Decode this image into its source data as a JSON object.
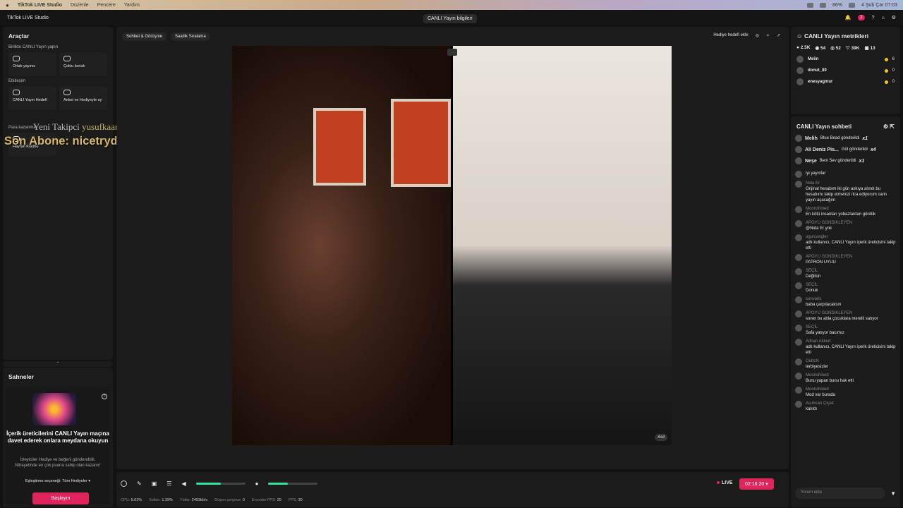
{
  "menubar": {
    "apple": "",
    "app": "TikTok LIVE Studio",
    "items": [
      "Düzenle",
      "Pencere",
      "Yardım"
    ],
    "battery": "86%",
    "datetime": "4 Şub Çar  07:03"
  },
  "titlebar": {
    "app_name": "TikTok LIVE Studio",
    "center": "CANLI Yayın bilgileri",
    "notif_count": "2"
  },
  "tools": {
    "title": "Araçlar",
    "section1": "Birlikte CANLI Yayın yapın",
    "btn1": "Ortak yayıncı",
    "btn2": "Çoklu konuk",
    "section2": "Etkileşim",
    "btn3": "CANLI Yayın Hedefi",
    "btn4": "Anket ve Hediyeyle oy",
    "section3": "Para kazanma",
    "btn5": "Hayran Kulübü"
  },
  "overlay": {
    "follower_label": "Yeni Takipci",
    "follower_name": "yusufkaan",
    "sub_label": "Son Abone: nicetrydiddyverynice"
  },
  "scenes": {
    "title": "Sahneler",
    "headline": "İçerik üreticilerini CANLI Yayın maçına davet ederek onlara meydana okuyun",
    "body": "İzleyiciler Hediye ve beğeni gönderebilir. Nihayetinde en çok puana sahip olan kazanır!",
    "selector": "Eşleştirme seçeneği: Tüm Hediyeler",
    "start": "Başlayın"
  },
  "stage": {
    "tab1": "Sohbet & Görüşme",
    "tab2": "Saatlik Sıralama",
    "gift_goal": "Hediye hedefi ekle",
    "asil": "Asil"
  },
  "controls": {
    "live": "LIVE",
    "timer": "02:16:20",
    "mic_level": 0.4,
    "speaker_level": 0.5,
    "stats": [
      {
        "k": "CPU:",
        "v": "5.02%"
      },
      {
        "k": "Selkin:",
        "v": "1.39%"
      },
      {
        "k": "Yükle:",
        "v": "2493kb/s"
      },
      {
        "k": "Düşen çerçeve:",
        "v": "0"
      },
      {
        "k": "Encoder FPS:",
        "v": "29"
      },
      {
        "k": "FPS:",
        "v": "30"
      }
    ]
  },
  "metrics": {
    "title": "CANLI Yayın metrikleri",
    "coins": "2.5K",
    "viewers": "54",
    "users": "52",
    "likes": "39K",
    "gifts": "13",
    "rows": [
      {
        "name": "Melin",
        "v": "6"
      },
      {
        "name": "donut_89",
        "v": "0"
      },
      {
        "name": "enesyagmur",
        "v": "0"
      }
    ]
  },
  "chat": {
    "title": "CANLI Yayın sohbeti",
    "gifts": [
      {
        "u": "Melih",
        "t": "Blue Bead gönderildi",
        "x": "x1"
      },
      {
        "u": "Ali Deniz Pis...",
        "t": "Gül gönderildi",
        "x": "x4"
      },
      {
        "u": "Neşe",
        "t": "Beni Sev gönderildi",
        "x": "x1"
      }
    ],
    "messages": [
      {
        "n": "",
        "t": "iyi yayınlar"
      },
      {
        "n": "Nida Er",
        "t": "Orijinal hesabım iki gün askıya alındı bu hesabımı takip etmenizi rica ediyorum canlı yayın açacağım"
      },
      {
        "n": "Moonshined",
        "t": "En kötü insanları yobazlardan gördük"
      },
      {
        "n": "APOYU GONDIKLEYEN",
        "t": "@Nida Er yok"
      },
      {
        "n": "ugurcangler",
        "t": "adlı kullanıcı, CANLI Yayın içerik üreticisini takip etti"
      },
      {
        "n": "APOYU GONDIKLEYEN",
        "t": "PATRON UYUU"
      },
      {
        "n": "SEÇİL",
        "t": "Değilsin"
      },
      {
        "n": "SEÇİL",
        "t": "Donuk"
      },
      {
        "n": "sonvaris",
        "t": "baba çarpılacaksın"
      },
      {
        "n": "APOYU GONDIKLEYEN",
        "t": "soner bu abla çocuklara mendil satıyor"
      },
      {
        "n": "SEÇİL",
        "t": "Safa yatıyor bacımız"
      },
      {
        "n": "Adnan Akkurt",
        "t": "adlı kullanıcı, CANLI Yayın içerik üreticisini takip etti"
      },
      {
        "n": "OuttcN",
        "t": "terbiyesizler"
      },
      {
        "n": "Moonshined",
        "t": "Bunu yapan bunu hak etti"
      },
      {
        "n": "Moonshined",
        "t": "Mod var burada"
      },
      {
        "n": "Asımcan Çiçek",
        "t": "katıldı"
      }
    ],
    "input_placeholder": "Yorum ekle"
  }
}
